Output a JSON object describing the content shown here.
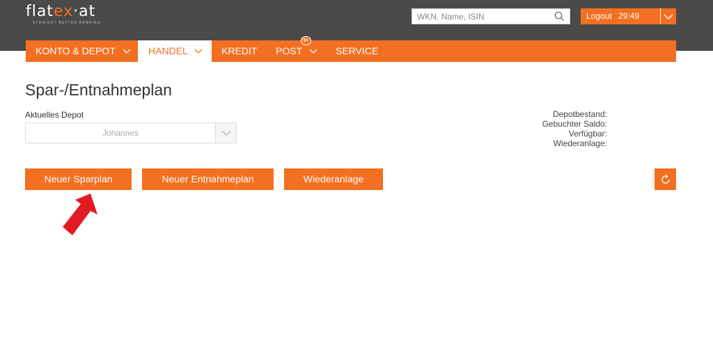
{
  "header": {
    "logo": {
      "text_main": "flat",
      "text_accent": "ex",
      "text_suffix": "·at",
      "tagline": "STRAIGHT BETTER BANKING"
    },
    "search": {
      "placeholder": "WKN, Name, ISIN",
      "value": ""
    },
    "logout": {
      "label": "Logout",
      "timer": "29:49"
    }
  },
  "nav": {
    "items": [
      {
        "label": "KONTO & DEPOT",
        "has_dropdown": true,
        "active": false
      },
      {
        "label": "HANDEL",
        "has_dropdown": true,
        "active": true
      },
      {
        "label": "KREDIT",
        "has_dropdown": false,
        "active": false
      },
      {
        "label": "POST",
        "has_dropdown": true,
        "active": false,
        "badge": "9+"
      },
      {
        "label": "SERVICE",
        "has_dropdown": false,
        "active": false
      }
    ]
  },
  "main": {
    "title": "Spar-/Entnahmeplan",
    "depot": {
      "label": "Aktuelles Depot",
      "value": "Johannes"
    },
    "summary": {
      "depotbestand": "Depotbestand:",
      "saldo": "Gebuchter Saldo:",
      "verfuegbar": "Verfügbar:",
      "wiederanlage": "Wiederanlage:"
    },
    "buttons": {
      "sparplan": "Neuer Sparplan",
      "entnahmeplan": "Neuer Entnahmeplan",
      "wiederanlage": "Wiederanlage"
    }
  },
  "colors": {
    "accent": "#f36f21",
    "header_bg": "#4a4a4a",
    "annotation_arrow": "#e01b24"
  },
  "icons": {
    "search": "search-icon",
    "caret": "chevron-down-icon",
    "refresh": "refresh-icon",
    "annotation": "red-arrow-icon"
  }
}
